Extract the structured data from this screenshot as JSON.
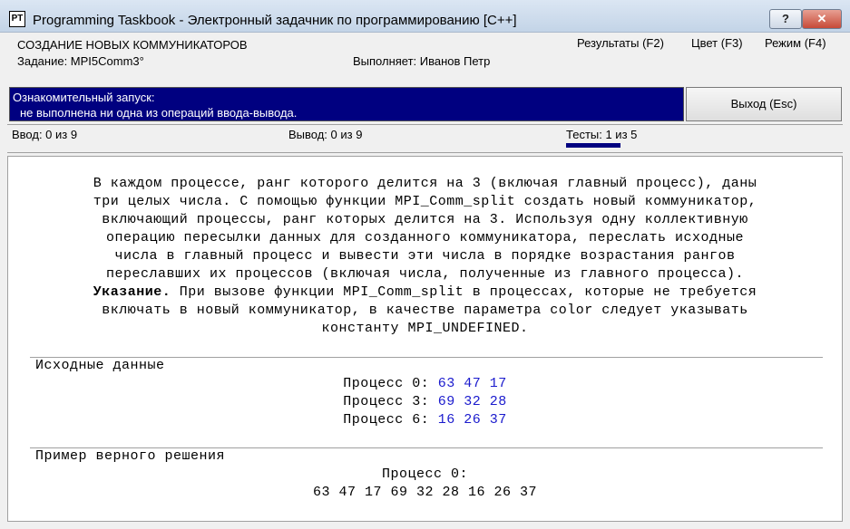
{
  "window": {
    "icon_text": "PT",
    "title": "Programming Taskbook - Электронный задачник по программированию [C++]",
    "help_label": "?",
    "close_label": "✕"
  },
  "header": {
    "group_title": "СОЗДАНИЕ НОВЫХ КОММУНИКАТОРОВ",
    "task_label": "Задание: MPI5Comm3°",
    "student_label": "Выполняет: Иванов Петр",
    "menu": {
      "results": "Результаты (F2)",
      "color": "Цвет (F3)",
      "mode": "Режим (F4)"
    }
  },
  "status": {
    "line1": "Ознакомительный запуск:",
    "line2": "не выполнена ни одна из операций ввода-вывода.",
    "exit_label": "Выход (Esc)"
  },
  "counters": {
    "input": "Ввод: 0 из 9",
    "output": "Вывод: 0 из 9",
    "tests": "Тесты: 1 из 5"
  },
  "task": {
    "lines": [
      "В каждом процессе, ранг которого делится на 3 (включая главный процесс), даны",
      "три целых числа. С помощью функции MPI_Comm_split создать новый коммуникатор,",
      "включающий процессы, ранг которых делится на 3. Используя одну коллективную",
      "операцию пересылки данных для созданного коммуникатора, переслать исходные",
      "числа в главный процесс и вывести эти числа в порядке возрастания рангов",
      "переславших их процессов (включая числа, полученные из главного процесса)."
    ],
    "hint_bold": "Указание.",
    "hint_rest": " При вызове функции MPI_Comm_split в процессах, которые не требуется",
    "hint_lines": [
      "включать в новый коммуникатор, в качестве параметра color следует указывать",
      "константу MPI_UNDEFINED."
    ]
  },
  "input_data": {
    "title": "Исходные данные",
    "processes": [
      {
        "label": "Процесс 0:",
        "values": "63 47 17"
      },
      {
        "label": "Процесс 3:",
        "values": "69 32 28"
      },
      {
        "label": "Процесс 6:",
        "values": "16 26 37"
      }
    ]
  },
  "example": {
    "title": "Пример верного решения",
    "process_label": "Процесс 0:",
    "values": "63 47 17 69 32 28 16 26 37"
  }
}
